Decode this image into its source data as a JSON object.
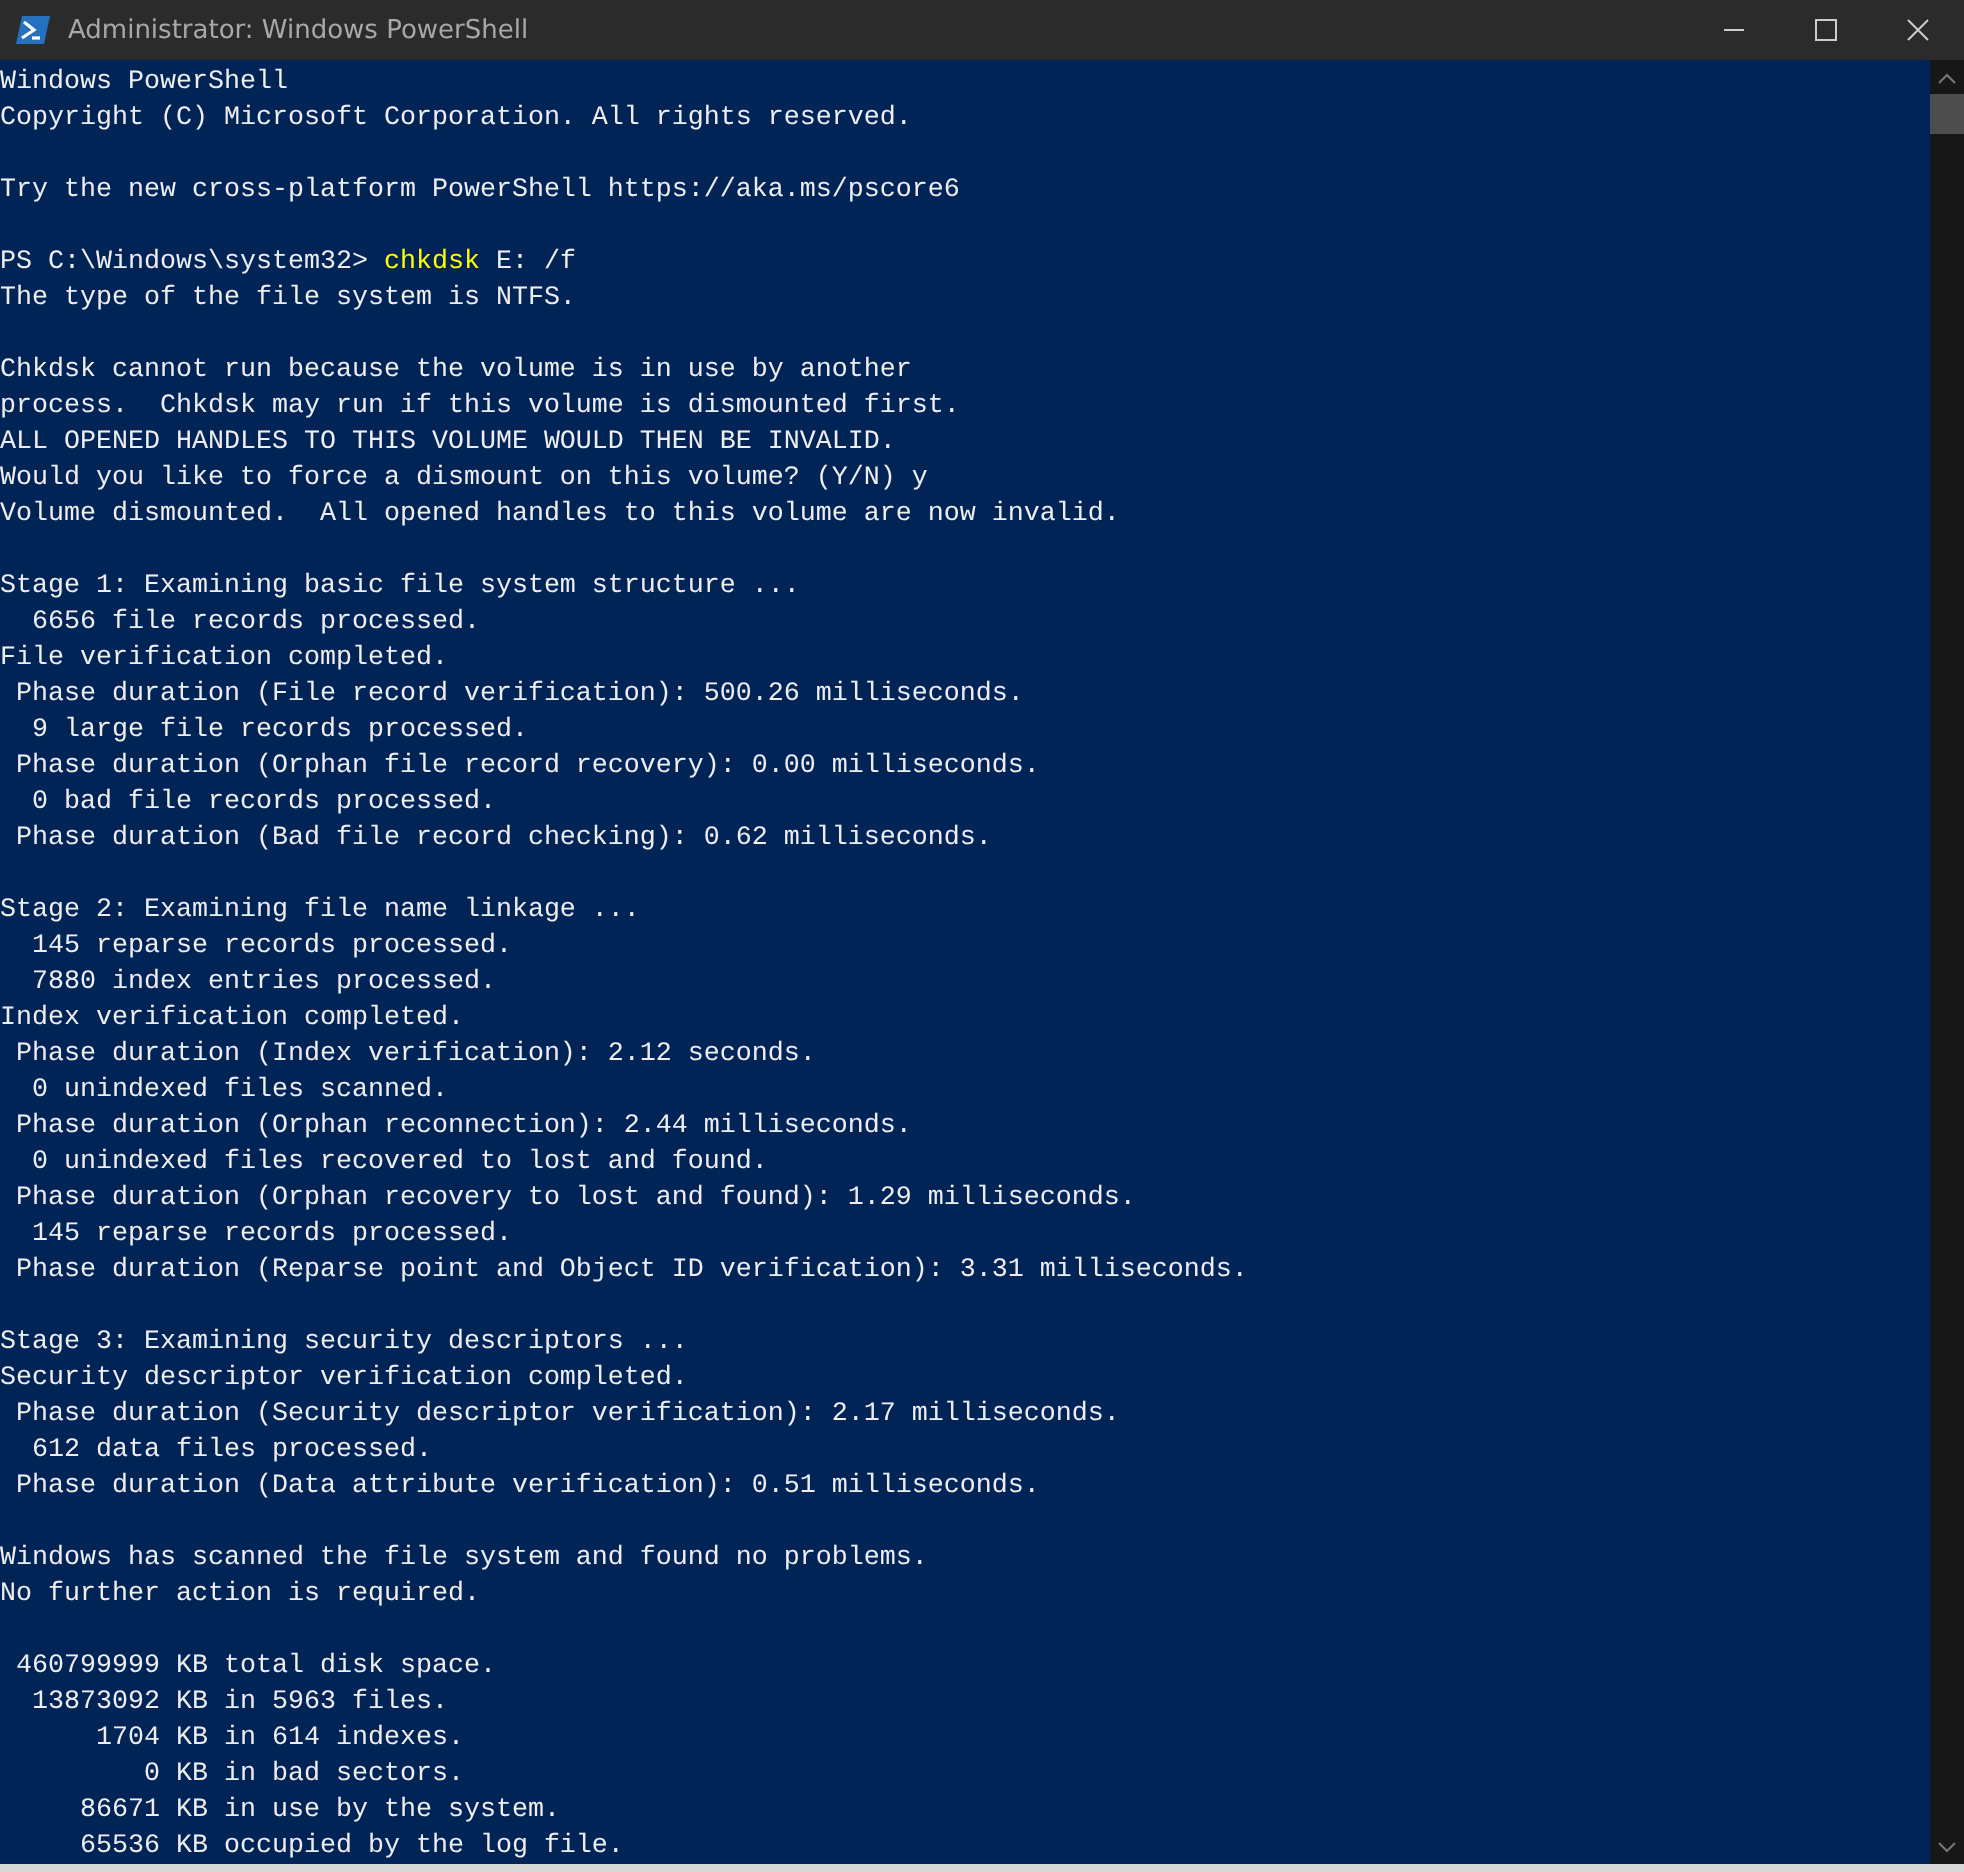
{
  "window": {
    "title": "Administrator: Windows PowerShell"
  },
  "console": {
    "lines": [
      {
        "kind": "text",
        "text": "Windows PowerShell"
      },
      {
        "kind": "text",
        "text": "Copyright (C) Microsoft Corporation. All rights reserved."
      },
      {
        "kind": "blank"
      },
      {
        "kind": "text",
        "text": "Try the new cross-platform PowerShell https://aka.ms/pscore6"
      },
      {
        "kind": "blank"
      },
      {
        "kind": "prompt",
        "prompt": "PS C:\\Windows\\system32> ",
        "command": "chkdsk",
        "args": " E: /f"
      },
      {
        "kind": "text",
        "text": "The type of the file system is NTFS."
      },
      {
        "kind": "blank"
      },
      {
        "kind": "text",
        "text": "Chkdsk cannot run because the volume is in use by another"
      },
      {
        "kind": "text",
        "text": "process.  Chkdsk may run if this volume is dismounted first."
      },
      {
        "kind": "text",
        "text": "ALL OPENED HANDLES TO THIS VOLUME WOULD THEN BE INVALID."
      },
      {
        "kind": "text",
        "text": "Would you like to force a dismount on this volume? (Y/N) y"
      },
      {
        "kind": "text",
        "text": "Volume dismounted.  All opened handles to this volume are now invalid."
      },
      {
        "kind": "blank"
      },
      {
        "kind": "text",
        "text": "Stage 1: Examining basic file system structure ..."
      },
      {
        "kind": "text",
        "text": "  6656 file records processed."
      },
      {
        "kind": "text",
        "text": "File verification completed."
      },
      {
        "kind": "text",
        "text": " Phase duration (File record verification): 500.26 milliseconds."
      },
      {
        "kind": "text",
        "text": "  9 large file records processed."
      },
      {
        "kind": "text",
        "text": " Phase duration (Orphan file record recovery): 0.00 milliseconds."
      },
      {
        "kind": "text",
        "text": "  0 bad file records processed."
      },
      {
        "kind": "text",
        "text": " Phase duration (Bad file record checking): 0.62 milliseconds."
      },
      {
        "kind": "blank"
      },
      {
        "kind": "text",
        "text": "Stage 2: Examining file name linkage ..."
      },
      {
        "kind": "text",
        "text": "  145 reparse records processed."
      },
      {
        "kind": "text",
        "text": "  7880 index entries processed."
      },
      {
        "kind": "text",
        "text": "Index verification completed."
      },
      {
        "kind": "text",
        "text": " Phase duration (Index verification): 2.12 seconds."
      },
      {
        "kind": "text",
        "text": "  0 unindexed files scanned."
      },
      {
        "kind": "text",
        "text": " Phase duration (Orphan reconnection): 2.44 milliseconds."
      },
      {
        "kind": "text",
        "text": "  0 unindexed files recovered to lost and found."
      },
      {
        "kind": "text",
        "text": " Phase duration (Orphan recovery to lost and found): 1.29 milliseconds."
      },
      {
        "kind": "text",
        "text": "  145 reparse records processed."
      },
      {
        "kind": "text",
        "text": " Phase duration (Reparse point and Object ID verification): 3.31 milliseconds."
      },
      {
        "kind": "blank"
      },
      {
        "kind": "text",
        "text": "Stage 3: Examining security descriptors ..."
      },
      {
        "kind": "text",
        "text": "Security descriptor verification completed."
      },
      {
        "kind": "text",
        "text": " Phase duration (Security descriptor verification): 2.17 milliseconds."
      },
      {
        "kind": "text",
        "text": "  612 data files processed."
      },
      {
        "kind": "text",
        "text": " Phase duration (Data attribute verification): 0.51 milliseconds."
      },
      {
        "kind": "blank"
      },
      {
        "kind": "text",
        "text": "Windows has scanned the file system and found no problems."
      },
      {
        "kind": "text",
        "text": "No further action is required."
      },
      {
        "kind": "blank"
      },
      {
        "kind": "text",
        "text": " 460799999 KB total disk space."
      },
      {
        "kind": "text",
        "text": "  13873092 KB in 5963 files."
      },
      {
        "kind": "text",
        "text": "      1704 KB in 614 indexes."
      },
      {
        "kind": "text",
        "text": "         0 KB in bad sectors."
      },
      {
        "kind": "text",
        "text": "     86671 KB in use by the system."
      },
      {
        "kind": "text",
        "text": "     65536 KB occupied by the log file."
      }
    ]
  }
}
